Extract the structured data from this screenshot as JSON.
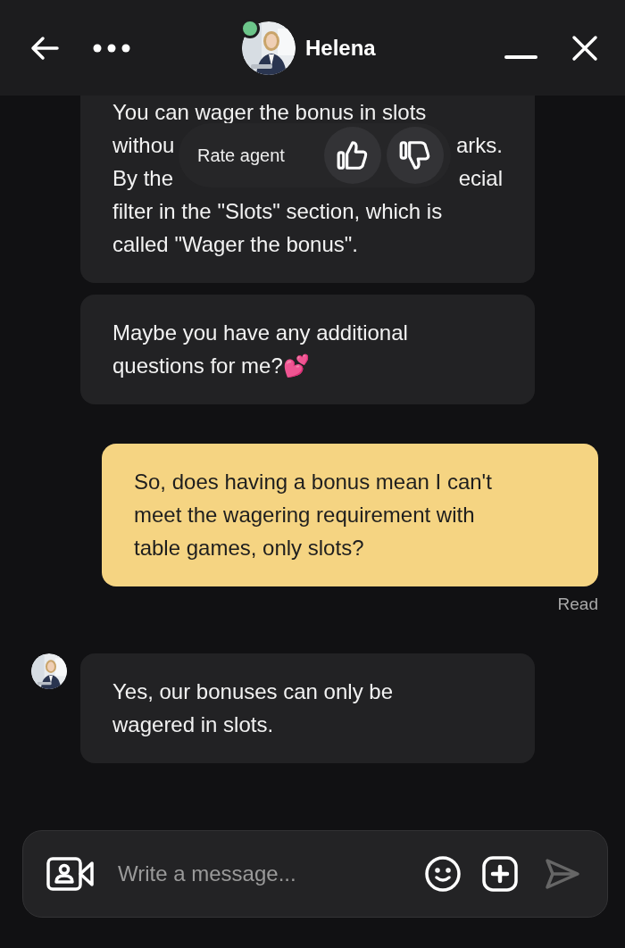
{
  "header": {
    "contact_name": "Helena",
    "online": true
  },
  "messages": [
    {
      "kind": "agent_partial",
      "avatar": false,
      "lines": [
        {
          "left": "You can wager the bonus in slots"
        },
        {
          "left": "withou",
          "right": "arks."
        },
        {
          "left": "By the",
          "right": "ecial"
        },
        {
          "left": "filter in the \"Slots\" section, which is"
        },
        {
          "left": "called \"Wager the bonus\"."
        }
      ]
    },
    {
      "kind": "agent",
      "avatar": false,
      "text": "Maybe you have any additional questions for me?💕"
    },
    {
      "kind": "user",
      "text": "So, does having a bonus mean I can't meet the wagering requirement with table games, only slots?",
      "status": "Read"
    },
    {
      "kind": "agent",
      "avatar": true,
      "text": "Yes, our bonuses can only be wagered in slots."
    }
  ],
  "rate_popup": {
    "label": "Rate agent"
  },
  "composer": {
    "placeholder": "Write a message..."
  }
}
